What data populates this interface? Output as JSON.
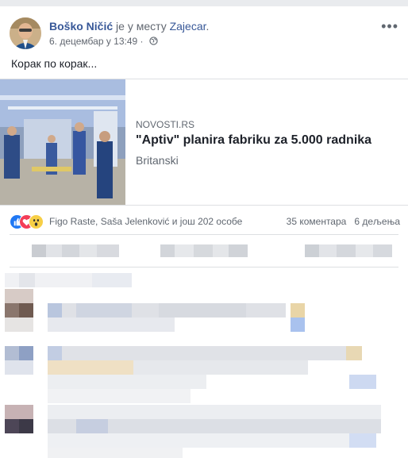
{
  "post": {
    "author": "Boško Ničić",
    "location_prefix": "је у месту",
    "location": "Zajecar",
    "location_suffix": ".",
    "timestamp": "6. децембар у 13:49",
    "dot": "·",
    "text": "Корак по корак...",
    "more_icon": "more-horizontal-icon",
    "privacy_icon": "globe-icon"
  },
  "link": {
    "domain": "NOVOSTI.RS",
    "title": "\"Aptiv\" planira fabriku za 5.000 radnika",
    "subtitle": "Britanski"
  },
  "reactions": {
    "icons": [
      "like-icon",
      "love-icon",
      "wow-icon"
    ],
    "names": "Figo Raste, Saša Jelenković и још 202 особе",
    "comments": "35 коментара",
    "shares": "6 дељења"
  },
  "colors": {
    "link_blue": "#385898",
    "meta_gray": "#616770",
    "like_blue": "#2078f4",
    "love_red": "#f33e58",
    "wow_yellow": "#f7cf46"
  }
}
